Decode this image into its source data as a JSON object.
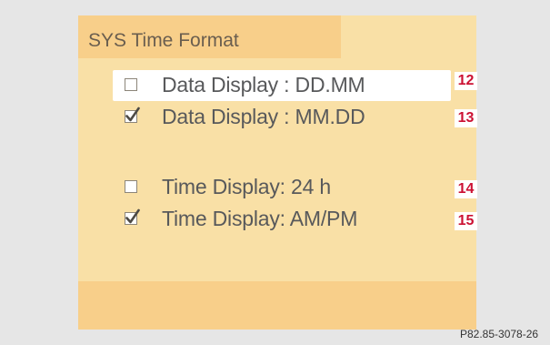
{
  "menu": {
    "title": "SYS Time Format",
    "options": [
      {
        "label": "Data Display : DD.MM",
        "checked": false,
        "highlighted": true,
        "callout": "12"
      },
      {
        "label": "Data Display : MM.DD",
        "checked": true,
        "highlighted": false,
        "callout": "13"
      },
      {
        "label": "Time Display: 24 h",
        "checked": false,
        "highlighted": false,
        "callout": "14"
      },
      {
        "label": "Time Display: AM/PM",
        "checked": true,
        "highlighted": false,
        "callout": "15"
      }
    ]
  },
  "figure_ref": "P82.85-3078-26",
  "icons": {
    "checked": "checkmark-icon"
  },
  "colors": {
    "screen_background": "#f9e0a6",
    "bar_background": "#f8cf8a",
    "highlight": "#ffffff",
    "callout_text": "#cc1133",
    "option_text": "#58595b"
  }
}
